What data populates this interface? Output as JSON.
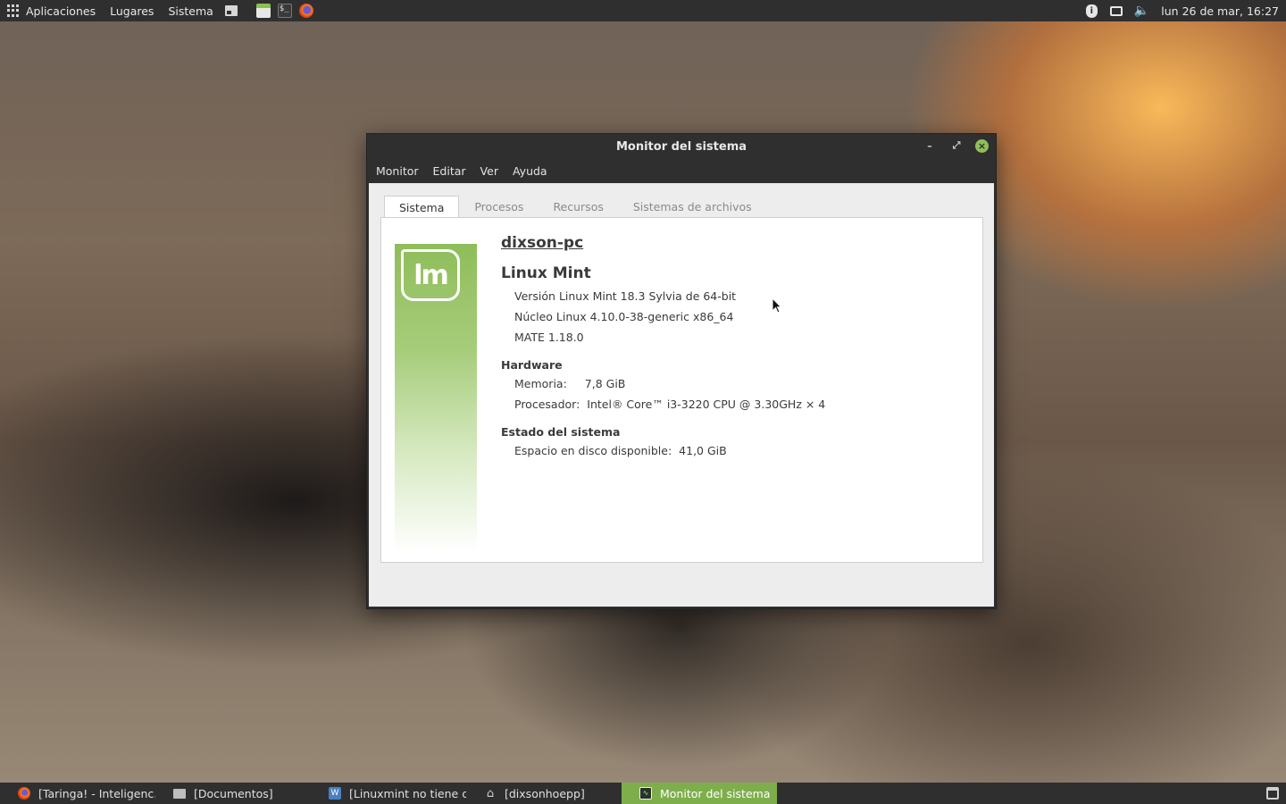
{
  "top_panel": {
    "applications": "Aplicaciones",
    "places": "Lugares",
    "system": "Sistema",
    "clock": "lun 26 de mar, 16:27"
  },
  "window": {
    "title": "Monitor del sistema",
    "menu": [
      "Monitor",
      "Editar",
      "Ver",
      "Ayuda"
    ],
    "tabs": [
      "Sistema",
      "Procesos",
      "Recursos",
      "Sistemas de archivos"
    ],
    "active_tab": "Sistema",
    "logo_text": "lm",
    "hostname": "dixson-pc",
    "distro": "Linux Mint",
    "version": "Versión Linux Mint 18.3 Sylvia de 64-bit",
    "kernel": "Núcleo Linux 4.10.0-38-generic x86_64",
    "desktop": "MATE 1.18.0",
    "hardware_title": "Hardware",
    "memory_label": "Memoria:",
    "memory_value": "7,8 GiB",
    "cpu_label": "Procesador:",
    "cpu_value": "Intel® Core™ i3-3220 CPU @ 3.30GHz × 4",
    "status_title": "Estado del sistema",
    "disk_label": "Espacio en disco disponible:",
    "disk_value": "41,0 GiB"
  },
  "taskbar": [
    {
      "label": "[Taringa! - Inteligenc...",
      "icon": "firefox-icon"
    },
    {
      "label": "[Documentos]",
      "icon": "folder-icon"
    },
    {
      "label": "[Linuxmint no tiene c...",
      "icon": "writer-icon"
    },
    {
      "label": "[dixsonhoepp]",
      "icon": "home-icon"
    },
    {
      "label": "Monitor del sistema",
      "icon": "system-monitor-icon"
    }
  ],
  "colors": {
    "panel": "#2f2f2f",
    "accent": "#7eae4c"
  }
}
